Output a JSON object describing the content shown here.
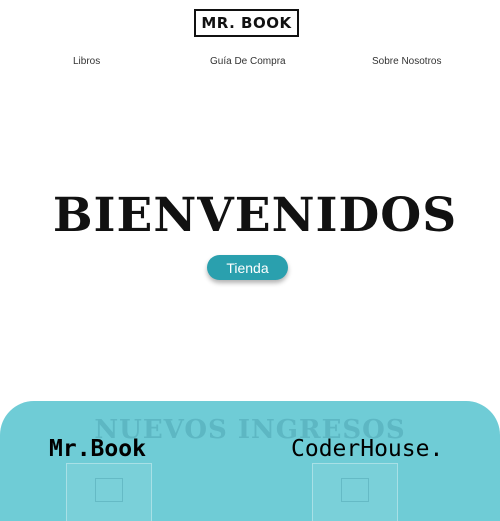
{
  "header": {
    "logo": "MR. BOOK"
  },
  "nav": {
    "items": [
      "Libros",
      "Guía De Compra",
      "Sobre Nosotros"
    ]
  },
  "hero": {
    "title": "BIENVENIDOS",
    "button": "Tienda"
  },
  "section": {
    "title": "NUEVOS INGRESOS"
  },
  "watermarks": {
    "left": "Mr.Book",
    "right": "CoderHouse."
  },
  "colors": {
    "accent": "#2aa0ae",
    "panel": "#6fccd6"
  }
}
